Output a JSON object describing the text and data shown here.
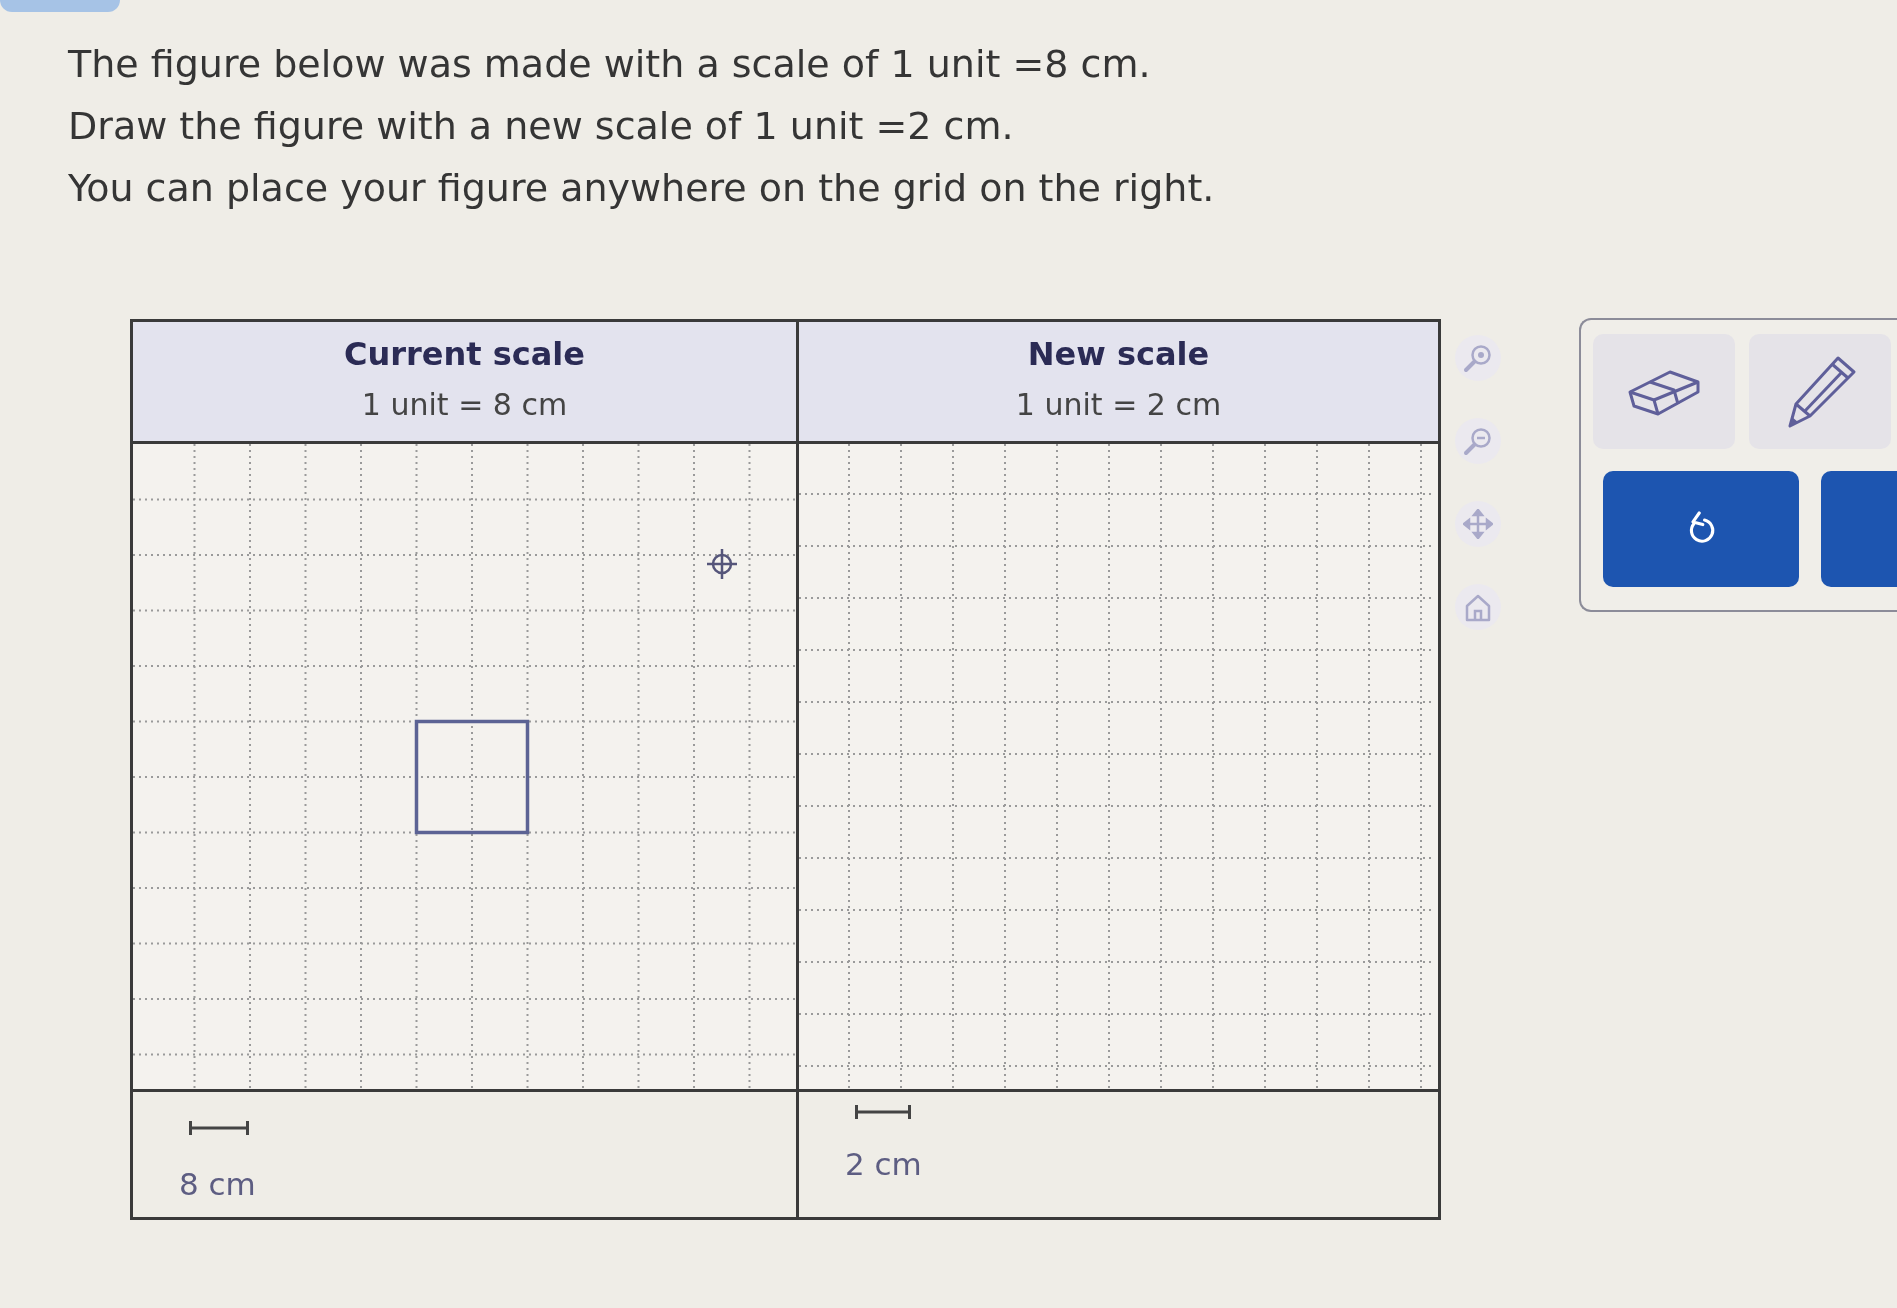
{
  "instructions": [
    "The figure below was made with a scale of 1 unit =8 cm.",
    "Draw the figure with a new scale of 1 unit =2 cm.",
    "You can place your figure anywhere on the grid on the right."
  ],
  "panels": [
    {
      "title": "Current scale",
      "scale": "1 unit = 8 cm",
      "figure": {
        "kind": "square"
      },
      "scale_bar_label": "8 cm"
    },
    {
      "title": "New scale",
      "scale": "1 unit = 2 cm",
      "scale_bar_label": "2 cm"
    }
  ]
}
